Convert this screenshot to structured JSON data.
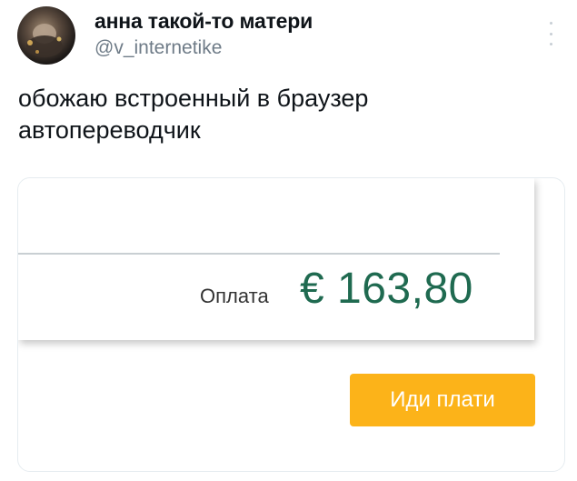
{
  "tweet": {
    "author": {
      "display_name": "анна такой-то матери",
      "handle": "@v_internetike"
    },
    "text_lines": [
      "обожаю встроенный в браузер",
      "автопереводчик"
    ],
    "more_icon": "more-vertical-icon"
  },
  "media": {
    "payment": {
      "label": "Оплата",
      "amount": "€ 163,80",
      "button_label": "Иди плати"
    },
    "colors": {
      "amount": "#1f6a50",
      "button": "#fcb319"
    }
  }
}
